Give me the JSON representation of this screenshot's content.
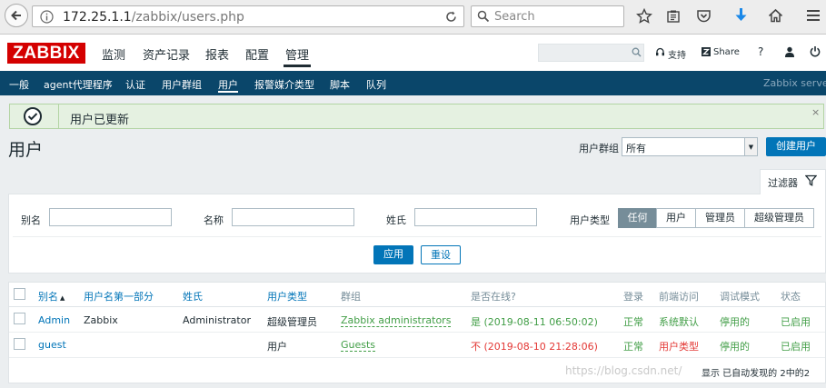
{
  "browser": {
    "url_host": "172.25.1.1",
    "url_path": "/zabbix/users.php",
    "search_placeholder": "Search"
  },
  "header": {
    "logo": "ZABBIX",
    "menu": [
      "监测",
      "资产记录",
      "报表",
      "配置",
      "管理"
    ],
    "active_menu": "管理",
    "support": "支持",
    "share": "Share",
    "help": "?"
  },
  "subnav": {
    "items": [
      "一般",
      "agent代理程序",
      "认证",
      "用户群组",
      "用户",
      "报警媒介类型",
      "脚本",
      "队列"
    ],
    "active": "用户",
    "server_name": "Zabbix server"
  },
  "message": {
    "text": "用户已更新",
    "close": "×"
  },
  "page": {
    "title": "用户",
    "group_label": "用户群组",
    "group_value": "所有",
    "create_button": "创建用户"
  },
  "filter": {
    "tab_label": "过滤器",
    "alias_label": "别名",
    "name_label": "名称",
    "surname_label": "姓氏",
    "type_label": "用户类型",
    "type_options": [
      "任何",
      "用户",
      "管理员",
      "超级管理员"
    ],
    "type_selected": "任何",
    "apply": "应用",
    "reset": "重设"
  },
  "table": {
    "headers": [
      "别名",
      "用户名第一部分",
      "姓氏",
      "用户类型",
      "群组",
      "是否在线?",
      "登录",
      "前端访问",
      "调试模式",
      "状态"
    ],
    "sort_indicator": "▲",
    "rows": [
      {
        "alias": "Admin",
        "name": "Zabbix",
        "surname": "Administrator",
        "type": "超级管理员",
        "groups": "Zabbix administrators",
        "online": "是 (2019-08-11 06:50:02)",
        "login": "正常",
        "frontend": "系统默认",
        "debug": "停用的",
        "status": "已启用"
      },
      {
        "alias": "guest",
        "name": "",
        "surname": "",
        "type": "用户",
        "groups": "Guests",
        "online": "不 (2019-08-10 21:28:06)",
        "login": "正常",
        "frontend": "用户类型",
        "debug": "停用的",
        "status": "已启用"
      }
    ],
    "footer": "显示 已自动发现的 2中的2"
  },
  "watermark": "https://blog.csdn.net/",
  "colors": {
    "brand_red": "#d40000",
    "nav_blue": "#0a466a",
    "link_blue": "#0275b8",
    "ok_green": "#429e47",
    "error_red": "#e33734"
  }
}
